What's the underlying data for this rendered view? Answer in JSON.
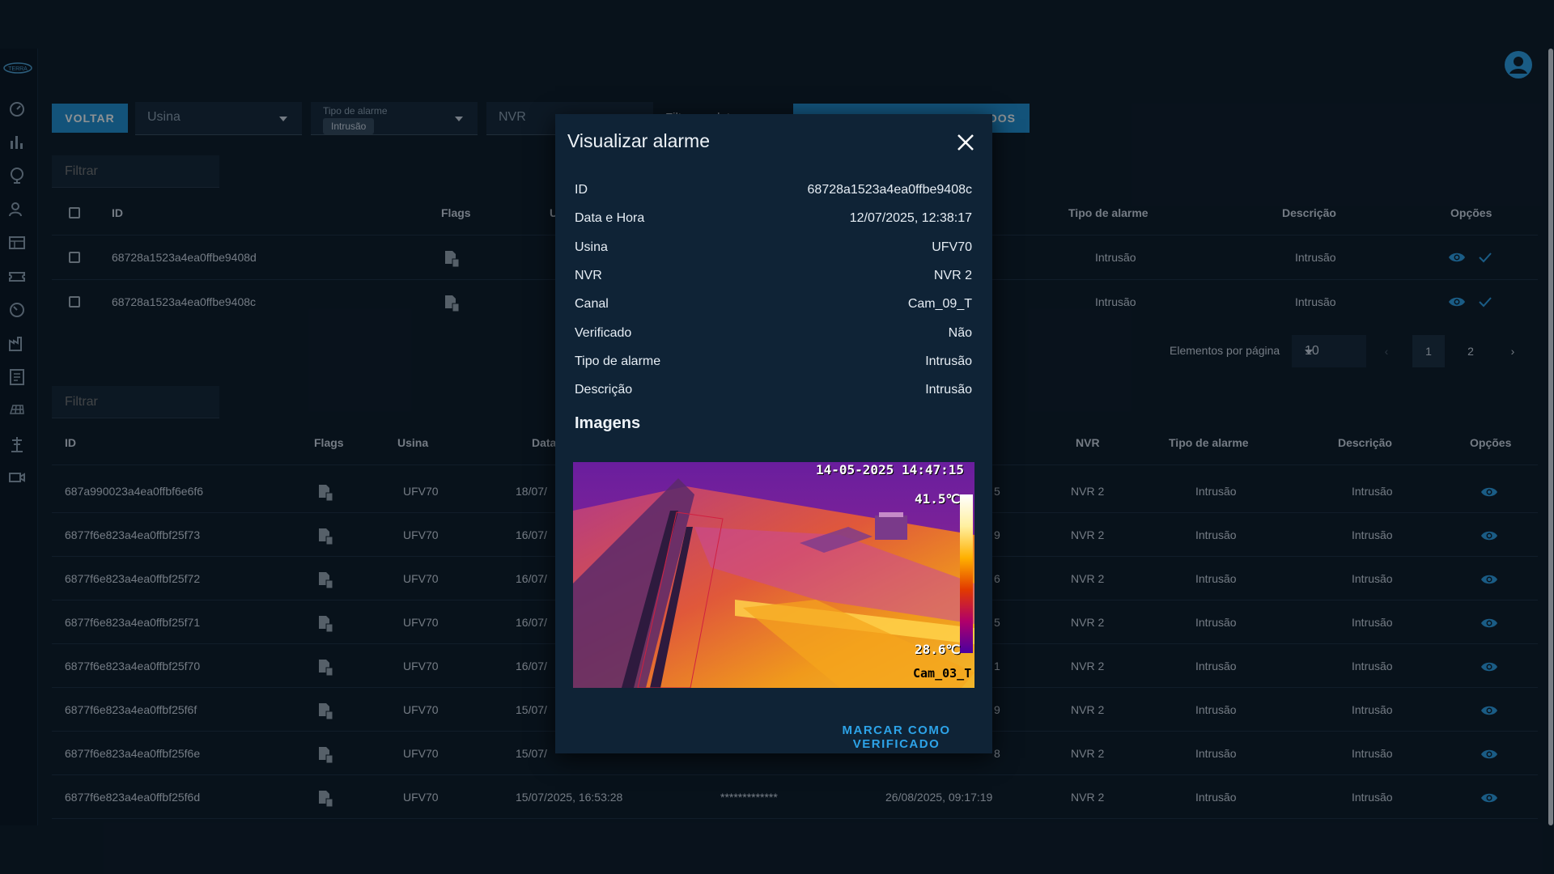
{
  "app": {
    "logo_text": "TERRA"
  },
  "toolbar": {
    "voltar_label": "VOLTAR",
    "usina_placeholder": "Usina",
    "tipo_alarme_label": "Tipo de alarme",
    "tipo_alarme_chip": "Intrusão",
    "nvr_placeholder": "NVR",
    "filtro_label": "Filtrar ... data",
    "verificar_label": "VERIFICAR ALARMES FILTRADOS"
  },
  "top_table": {
    "filter_placeholder": "Filtrar",
    "headers": {
      "id": "ID",
      "flags": "Flags",
      "usina": "U",
      "tipo": "Tipo de alarme",
      "descricao": "Descrição",
      "opcoes": "Opções"
    },
    "rows": [
      {
        "id": "68728a1523a4ea0ffbe9408d",
        "tipo": "Intrusão",
        "descricao": "Intrusão"
      },
      {
        "id": "68728a1523a4ea0ffbe9408c",
        "tipo": "Intrusão",
        "descricao": "Intrusão"
      }
    ],
    "pagination": {
      "label": "Elementos por página",
      "per_page": "10",
      "prev": "‹",
      "next": "›",
      "pages": [
        "1",
        "2"
      ],
      "current": "1"
    }
  },
  "bottom_table": {
    "filter_placeholder": "Filtrar",
    "headers": {
      "id": "ID",
      "flags": "Flags",
      "usina": "Usina",
      "data": "Data",
      "nvr": "NVR",
      "tipo": "Tipo de alarme",
      "descricao": "Descrição",
      "opcoes": "Opções"
    },
    "rows": [
      {
        "id": "687a990023a4ea0ffbf6e6f6",
        "usina": "UFV70",
        "data": "18/07/",
        "verif": "5",
        "nvr": "NVR 2",
        "tipo": "Intrusão",
        "descricao": "Intrusão"
      },
      {
        "id": "6877f6e823a4ea0ffbf25f73",
        "usina": "UFV70",
        "data": "16/07/",
        "verif": "9",
        "nvr": "NVR 2",
        "tipo": "Intrusão",
        "descricao": "Intrusão"
      },
      {
        "id": "6877f6e823a4ea0ffbf25f72",
        "usina": "UFV70",
        "data": "16/07/",
        "verif": "6",
        "nvr": "NVR 2",
        "tipo": "Intrusão",
        "descricao": "Intrusão"
      },
      {
        "id": "6877f6e823a4ea0ffbf25f71",
        "usina": "UFV70",
        "data": "16/07/",
        "verif": "5",
        "nvr": "NVR 2",
        "tipo": "Intrusão",
        "descricao": "Intrusão"
      },
      {
        "id": "6877f6e823a4ea0ffbf25f70",
        "usina": "UFV70",
        "data": "16/07/",
        "verif": "1",
        "nvr": "NVR 2",
        "tipo": "Intrusão",
        "descricao": "Intrusão"
      },
      {
        "id": "6877f6e823a4ea0ffbf25f6f",
        "usina": "UFV70",
        "data": "15/07/",
        "verif": "9",
        "nvr": "NVR 2",
        "tipo": "Intrusão",
        "descricao": "Intrusão"
      },
      {
        "id": "6877f6e823a4ea0ffbf25f6e",
        "usina": "UFV70",
        "data": "15/07/",
        "verif": "8",
        "nvr": "NVR 2",
        "tipo": "Intrusão",
        "descricao": "Intrusão"
      },
      {
        "id": "6877f6e823a4ea0ffbf25f6d",
        "usina": "UFV70",
        "data": "15/07/2025, 16:53:28",
        "mask": "*************",
        "verif": "26/08/2025, 09:17:19",
        "nvr": "NVR 2",
        "tipo": "Intrusão",
        "descricao": "Intrusão"
      }
    ]
  },
  "modal": {
    "title": "Visualizar alarme",
    "fields": [
      {
        "k": "ID",
        "v": "68728a1523a4ea0ffbe9408c"
      },
      {
        "k": "Data e Hora",
        "v": "12/07/2025, 12:38:17"
      },
      {
        "k": "Usina",
        "v": "UFV70"
      },
      {
        "k": "NVR",
        "v": "NVR 2"
      },
      {
        "k": "Canal",
        "v": "Cam_09_T"
      },
      {
        "k": "Verificado",
        "v": "Não"
      },
      {
        "k": "Tipo de alarme",
        "v": "Intrusão"
      },
      {
        "k": "Descrição",
        "v": "Intrusão"
      }
    ],
    "images_title": "Imagens",
    "image": {
      "timestamp": "14-05-2025 14:47:15",
      "temp_max": "41.5℃",
      "temp_min": "28.6℃",
      "camera": "Cam_03_T"
    },
    "action_label": "MARCAR COMO VERIFICADO"
  },
  "colors": {
    "accent": "#1f8fd1",
    "background": "#0c1826",
    "modal_bg": "#0f2336"
  },
  "icons": [
    "logo-icon",
    "dashboard-icon",
    "bar-chart-icon",
    "globe-icon",
    "user-search-icon",
    "dashboard-grid-icon",
    "ticket-icon",
    "speedometer-icon",
    "factory-icon",
    "report-icon",
    "solar-panel-icon",
    "tower-icon",
    "camera-icon",
    "user-avatar-icon",
    "flag-file-icon",
    "eye-icon",
    "check-icon",
    "close-icon"
  ]
}
